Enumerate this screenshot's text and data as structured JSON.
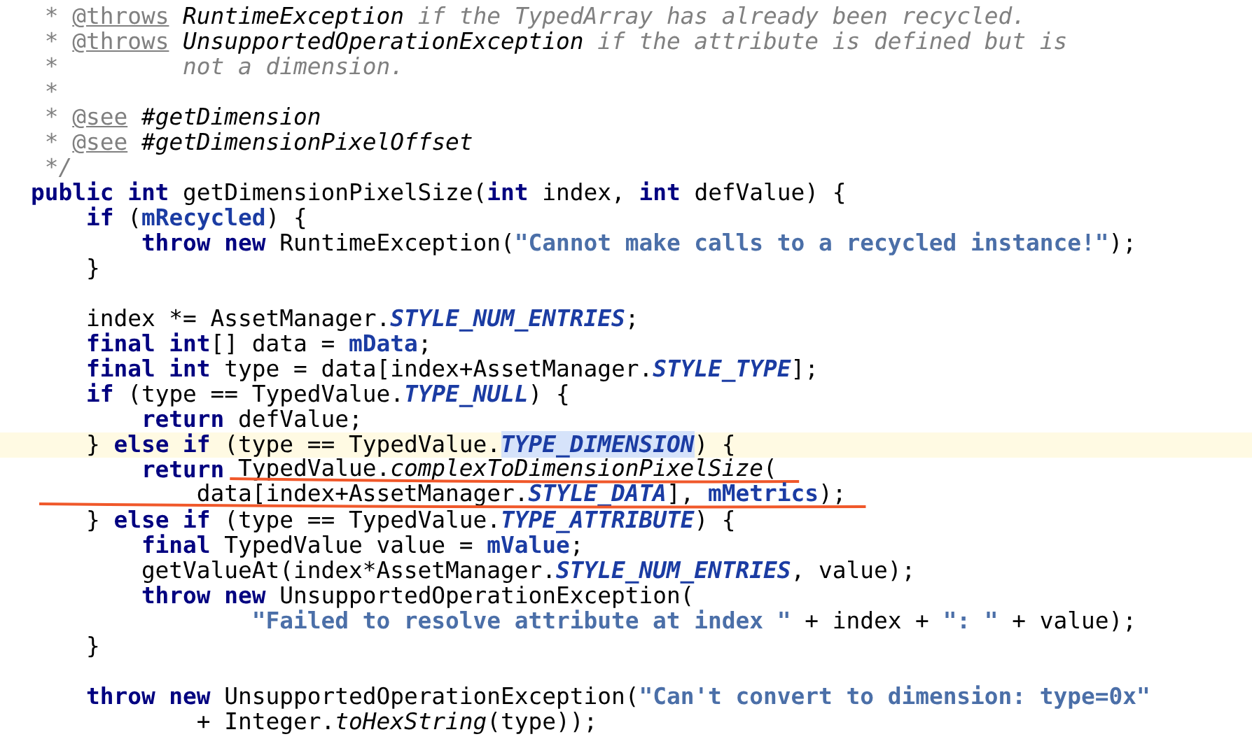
{
  "editor": {
    "lines": [
      {
        "current": false,
        "tokens": [
          {
            "text": " * ",
            "kind": "cm"
          },
          {
            "text": "@throws",
            "kind": "tag"
          },
          {
            "text": " RuntimeException",
            "kind": "cref"
          },
          {
            "text": " if the TypedArray has already been recycled.",
            "kind": "cm"
          }
        ]
      },
      {
        "current": false,
        "tokens": [
          {
            "text": " * ",
            "kind": "cm"
          },
          {
            "text": "@throws",
            "kind": "tag"
          },
          {
            "text": " UnsupportedOperationException",
            "kind": "cref"
          },
          {
            "text": " if the attribute is defined but is",
            "kind": "cm"
          }
        ]
      },
      {
        "current": false,
        "tokens": [
          {
            "text": " *         not a dimension.",
            "kind": "cm"
          }
        ]
      },
      {
        "current": false,
        "tokens": [
          {
            "text": " *",
            "kind": "cm"
          }
        ]
      },
      {
        "current": false,
        "tokens": [
          {
            "text": " * ",
            "kind": "cm"
          },
          {
            "text": "@see",
            "kind": "tag"
          },
          {
            "text": " #getDimension",
            "kind": "cref"
          }
        ]
      },
      {
        "current": false,
        "tokens": [
          {
            "text": " * ",
            "kind": "cm"
          },
          {
            "text": "@see",
            "kind": "tag"
          },
          {
            "text": " #getDimensionPixelOffset",
            "kind": "cref"
          }
        ]
      },
      {
        "current": false,
        "tokens": [
          {
            "text": " */",
            "kind": "cm"
          }
        ]
      },
      {
        "current": false,
        "tokens": [
          {
            "text": "public int",
            "kind": "kw"
          },
          {
            "text": " getDimensionPixelSize(",
            "kind": "p"
          },
          {
            "text": "int",
            "kind": "kw"
          },
          {
            "text": " index, ",
            "kind": "p"
          },
          {
            "text": "int",
            "kind": "kw"
          },
          {
            "text": " defValue) {",
            "kind": "p"
          }
        ]
      },
      {
        "current": false,
        "tokens": [
          {
            "text": "    if",
            "kind": "kw"
          },
          {
            "text": " (",
            "kind": "p"
          },
          {
            "text": "mRecycled",
            "kind": "field"
          },
          {
            "text": ") {",
            "kind": "p"
          }
        ]
      },
      {
        "current": false,
        "tokens": [
          {
            "text": "        throw new",
            "kind": "kw"
          },
          {
            "text": " RuntimeException(",
            "kind": "p"
          },
          {
            "text": "\"Cannot make calls to a recycled instance!\"",
            "kind": "str"
          },
          {
            "text": ");",
            "kind": "p"
          }
        ]
      },
      {
        "current": false,
        "tokens": [
          {
            "text": "    }",
            "kind": "p"
          }
        ]
      },
      {
        "current": false
      },
      {
        "current": false,
        "tokens": [
          {
            "text": "    index *= AssetManager.",
            "kind": "p"
          },
          {
            "text": "STYLE_NUM_ENTRIES",
            "kind": "static"
          },
          {
            "text": ";",
            "kind": "p"
          }
        ]
      },
      {
        "current": false,
        "tokens": [
          {
            "text": "    final int",
            "kind": "kw"
          },
          {
            "text": "[] data = ",
            "kind": "p"
          },
          {
            "text": "mData",
            "kind": "field"
          },
          {
            "text": ";",
            "kind": "p"
          }
        ]
      },
      {
        "current": false,
        "tokens": [
          {
            "text": "    final int",
            "kind": "kw"
          },
          {
            "text": " type = data[index+AssetManager.",
            "kind": "p"
          },
          {
            "text": "STYLE_TYPE",
            "kind": "static"
          },
          {
            "text": "];",
            "kind": "p"
          }
        ]
      },
      {
        "current": false,
        "tokens": [
          {
            "text": "    if",
            "kind": "kw"
          },
          {
            "text": " (type == TypedValue.",
            "kind": "p"
          },
          {
            "text": "TYPE_NULL",
            "kind": "static"
          },
          {
            "text": ") {",
            "kind": "p"
          }
        ]
      },
      {
        "current": false,
        "tokens": [
          {
            "text": "        return",
            "kind": "kw"
          },
          {
            "text": " defValue;",
            "kind": "p"
          }
        ]
      },
      {
        "current": true,
        "tokens": [
          {
            "text": "    } ",
            "kind": "p"
          },
          {
            "text": "else if",
            "kind": "kw"
          },
          {
            "text": " (type == TypedValue.",
            "kind": "p"
          },
          {
            "text": "TYPE_DIMENSION",
            "kind": "static-hl"
          },
          {
            "text": ") {",
            "kind": "p"
          }
        ]
      },
      {
        "current": false,
        "tokens": [
          {
            "text": "        return",
            "kind": "kw"
          },
          {
            "kind": "underlined",
            "tokens": [
              {
                "text": " TypedValue.",
                "kind": "p"
              },
              {
                "text": "complexToDimensionPixelSize",
                "kind": "mi"
              },
              {
                "text": "(",
                "kind": "p"
              }
            ]
          }
        ]
      },
      {
        "current": false,
        "tokens": [
          {
            "kind": "underlined",
            "tokens": [
              {
                "text": "            data[index+AssetManager.",
                "kind": "p"
              },
              {
                "text": "STYLE_DATA",
                "kind": "static"
              },
              {
                "text": "], ",
                "kind": "p"
              },
              {
                "text": "mMetrics",
                "kind": "field"
              },
              {
                "text": ");",
                "kind": "p"
              }
            ]
          }
        ]
      },
      {
        "current": false,
        "tokens": [
          {
            "text": "    } ",
            "kind": "p"
          },
          {
            "text": "else if",
            "kind": "kw"
          },
          {
            "text": " (type == TypedValue.",
            "kind": "p"
          },
          {
            "text": "TYPE_ATTRIBUTE",
            "kind": "static"
          },
          {
            "text": ") {",
            "kind": "p"
          }
        ]
      },
      {
        "current": false,
        "tokens": [
          {
            "text": "        final",
            "kind": "kw"
          },
          {
            "text": " TypedValue value = ",
            "kind": "p"
          },
          {
            "text": "mValue",
            "kind": "field"
          },
          {
            "text": ";",
            "kind": "p"
          }
        ]
      },
      {
        "current": false,
        "tokens": [
          {
            "text": "        getValueAt(index*AssetManager.",
            "kind": "p"
          },
          {
            "text": "STYLE_NUM_ENTRIES",
            "kind": "static"
          },
          {
            "text": ", value);",
            "kind": "p"
          }
        ]
      },
      {
        "current": false,
        "tokens": [
          {
            "text": "        throw new",
            "kind": "kw"
          },
          {
            "text": " UnsupportedOperationException(",
            "kind": "p"
          }
        ]
      },
      {
        "current": false,
        "tokens": [
          {
            "text": "                \"Failed to resolve attribute at index \"",
            "kind": "str"
          },
          {
            "text": " + index + ",
            "kind": "p"
          },
          {
            "text": "\": \"",
            "kind": "str"
          },
          {
            "text": " + value);",
            "kind": "p"
          }
        ]
      },
      {
        "current": false,
        "tokens": [
          {
            "text": "    }",
            "kind": "p"
          }
        ]
      },
      {
        "current": false
      },
      {
        "current": false,
        "tokens": [
          {
            "text": "    throw new",
            "kind": "kw"
          },
          {
            "text": " UnsupportedOperationException(",
            "kind": "p"
          },
          {
            "text": "\"Can't convert to dimension: type=0x\"",
            "kind": "str"
          }
        ]
      },
      {
        "current": false,
        "tokens": [
          {
            "text": "            + Integer.",
            "kind": "p"
          },
          {
            "text": "toHexString",
            "kind": "mi"
          },
          {
            "text": "(type));",
            "kind": "p"
          }
        ]
      }
    ]
  }
}
